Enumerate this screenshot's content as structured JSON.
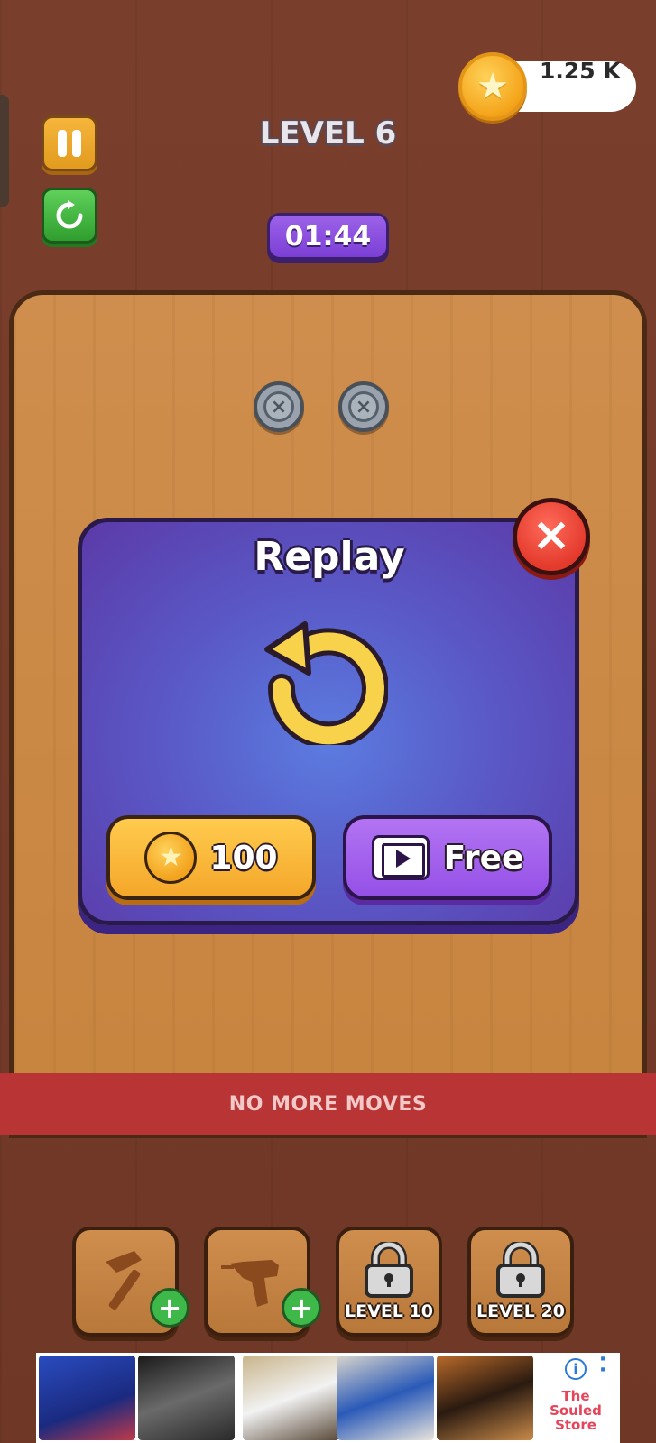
{
  "hud": {
    "coins": "1.25 K",
    "level": "LEVEL 6",
    "timer": "01:44"
  },
  "dialog": {
    "title": "Replay",
    "coin_cost": "100",
    "free_label": "Free"
  },
  "banner": {
    "text": "NO MORE MOVES"
  },
  "tools": [
    {
      "name": "hammer",
      "locked": false
    },
    {
      "name": "drill",
      "locked": false
    },
    {
      "name": "locked",
      "locked": true,
      "label": "LEVEL 10"
    },
    {
      "name": "locked",
      "locked": true,
      "label": "LEVEL 20"
    }
  ],
  "ad": {
    "brand": "The Souled Store"
  },
  "colors": {
    "wood_dark": "#7a3f2c",
    "board": "#c7843f",
    "dialog": "#5a5ac8",
    "banner": "#b93434",
    "coin": "#f4a41a",
    "free_button": "#9450e6"
  }
}
